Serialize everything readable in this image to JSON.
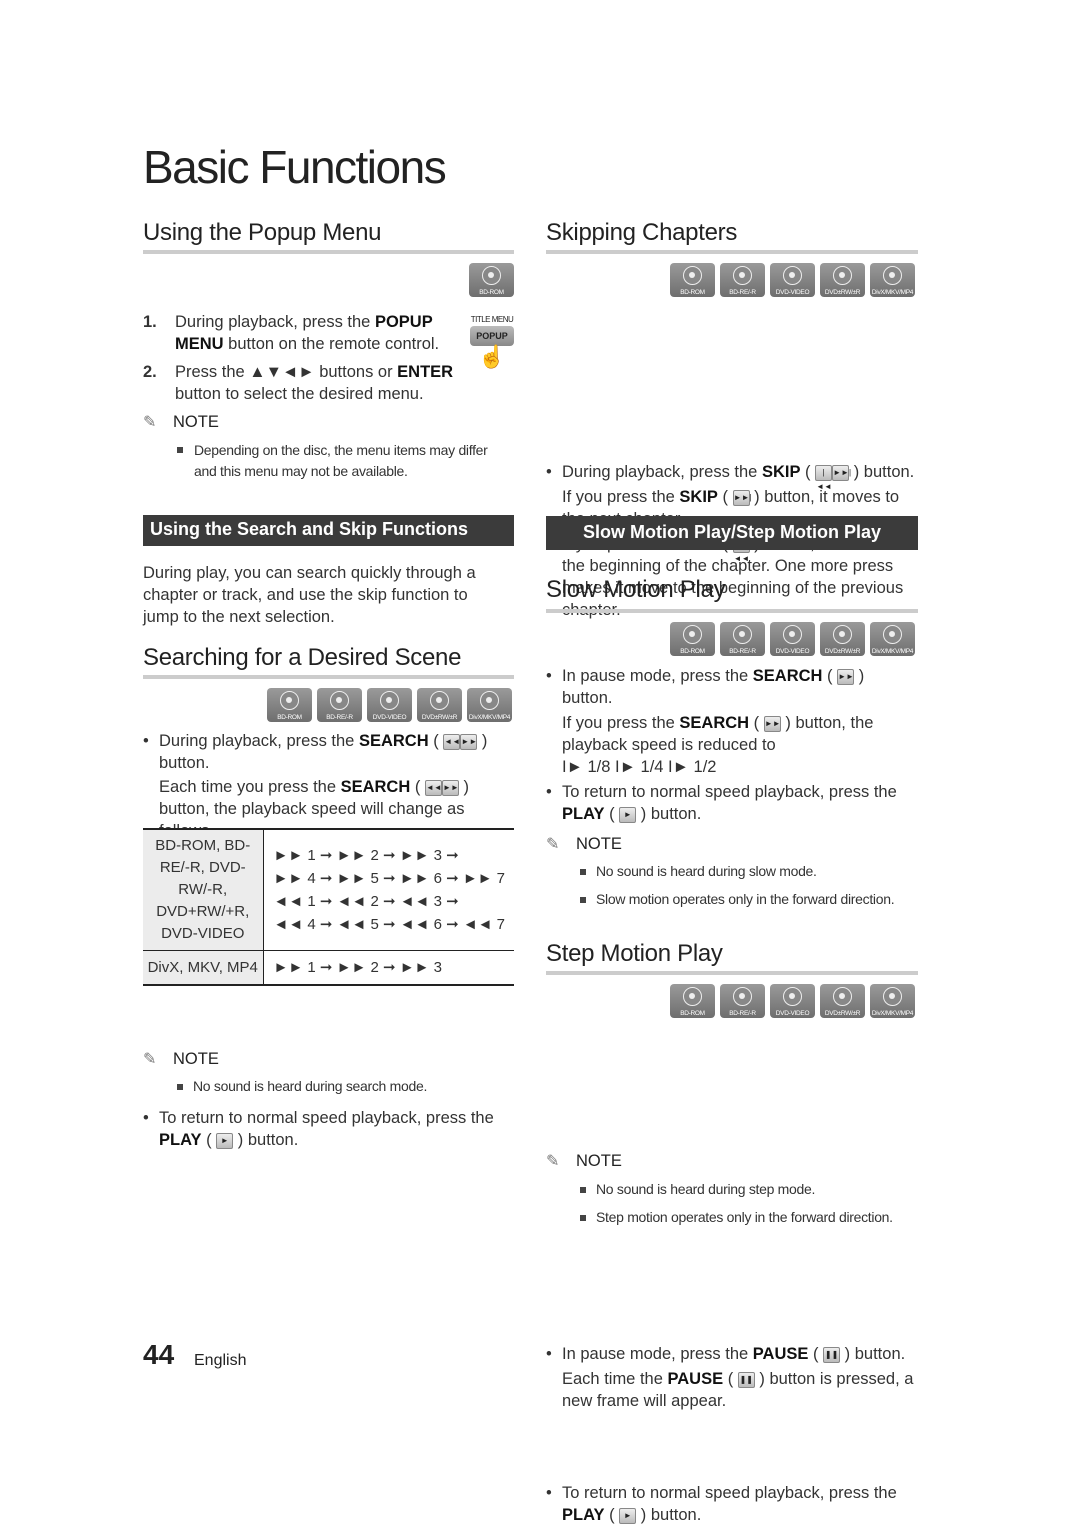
{
  "title": "Basic Functions",
  "discs": [
    "BD-ROM",
    "BD-RE/-R",
    "DVD-VIDEO",
    "DVD±RW/±R",
    "DivX/MKV/MP4"
  ],
  "popup": {
    "heading": "Using the Popup Menu",
    "badge": "BD-ROM",
    "remote_top": "TITLE MENU",
    "remote_btn": "POPUP",
    "s1n": "1.",
    "s1a": "During playback, press the ",
    "s1b": "POPUP MENU",
    "s1c": " button on the remote control.",
    "s2n": "2.",
    "s2a": "Press the ▲▼◄► buttons or ",
    "s2b": "ENTER",
    "s2c": " button to select the desired menu.",
    "note": "NOTE",
    "n1": "Depending on the disc, the menu items may differ and this menu may not be available."
  },
  "searchskip": {
    "band": "Using the Search and Skip Functions",
    "intro": "During play, you can search quickly through a chapter or track, and use the skip function to jump to the next selection."
  },
  "search": {
    "heading": "Searching for a Desired Scene",
    "b1a": "During playback, press the ",
    "b1b": "SEARCH",
    "b1c": " button.",
    "b1d": "Each time you press the ",
    "b1e": "SEARCH",
    "b1f": " button, the playback speed will change as follows.",
    "table": [
      [
        "BD-ROM, BD-RE/-R, DVD-RW/-R, DVD+RW/+R, DVD-VIDEO",
        [
          "►► 1 ➞ ►► 2 ➞ ►► 3 ➞",
          "►► 4 ➞ ►► 5 ➞ ►► 6 ➞ ►► 7",
          "◄◄ 1 ➞ ◄◄ 2 ➞ ◄◄ 3 ➞",
          "◄◄ 4 ➞ ◄◄ 5 ➞ ◄◄ 6 ➞ ◄◄ 7"
        ]
      ],
      [
        "DivX, MKV, MP4",
        [
          "►► 1 ➞ ►► 2 ➞ ►► 3"
        ]
      ]
    ],
    "b2a": "To return to normal speed playback, press the ",
    "b2b": "PLAY",
    "b2c": " button.",
    "note": "NOTE",
    "n1": "No sound is heard during search mode."
  },
  "skip": {
    "heading": "Skipping Chapters",
    "b1a": "During playback, press the ",
    "b1b": "SKIP",
    "b1c": " button.",
    "p2a": "If you press the ",
    "p2b": "SKIP",
    "p2c": " button, it moves to the next chapter.",
    "p3a": "If you press the ",
    "p3b": "SKIP",
    "p3c": " button, it moves to the beginning of the chapter. One more press makes it move to the beginning of the previous chapter."
  },
  "slowstep": {
    "band": "Slow Motion Play/Step Motion Play"
  },
  "slow": {
    "heading": "Slow Motion Play",
    "b1a": "In pause mode, press the ",
    "b1b": "SEARCH",
    "b1c": " button.",
    "p2a": "If you press the ",
    "p2b": "SEARCH",
    "p2c": " button, the playback speed is reduced to",
    "speeds": "I► 1/8 I► 1/4 I► 1/2",
    "b2a": "To return to normal speed playback, press the ",
    "b2b": "PLAY",
    "b2c": " button.",
    "note": "NOTE",
    "n1": "No sound is heard during slow mode.",
    "n2": "Slow motion operates only in the forward direction."
  },
  "step": {
    "heading": "Step Motion Play",
    "b1a": "In pause mode, press the ",
    "b1b": "PAUSE",
    "b1c": " button.",
    "p2a": "Each time the ",
    "p2b": "PAUSE",
    "p2c": " button is pressed, a new frame will appear.",
    "b2a": "To return to normal speed playback, press the ",
    "b2b": "PLAY",
    "b2c": " button.",
    "note": "NOTE",
    "n1": "No sound is heard during step mode.",
    "n2": "Step motion operates only in the forward direction."
  },
  "footer": {
    "page": "44",
    "lang": "English"
  }
}
